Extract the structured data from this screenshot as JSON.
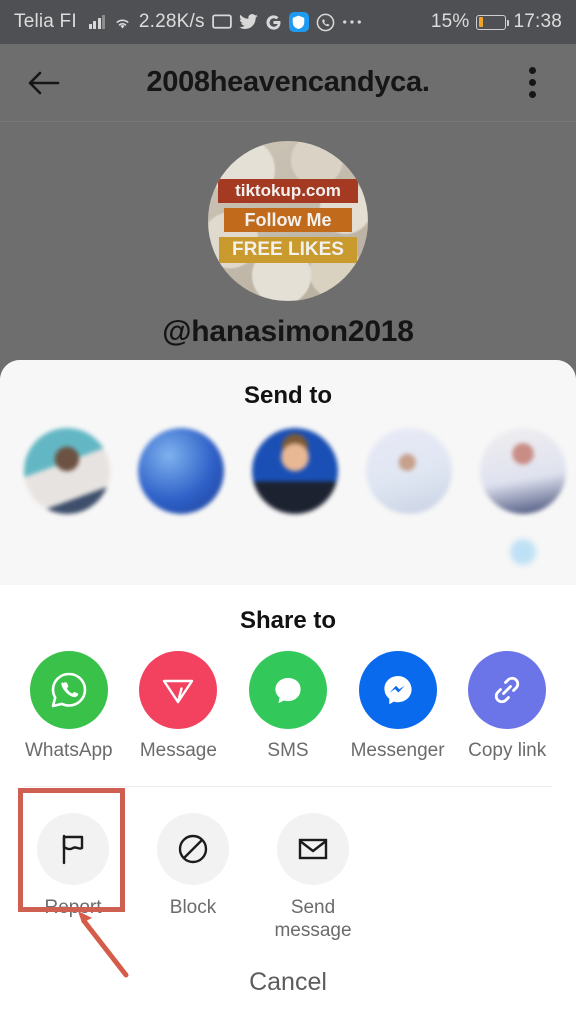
{
  "statusbar": {
    "carrier": "Telia FI",
    "network_speed": "2.28K/s",
    "battery_percent": "15%",
    "clock": "17:38",
    "icons": [
      "signal-icon",
      "wifi-icon",
      "cast-icon",
      "twitter-icon",
      "google-icon",
      "shield-icon",
      "whatsapp-icon",
      "overflow-dots-icon"
    ],
    "battery_fill_color": "#f0a52a"
  },
  "header": {
    "title": "2008heavencandyca.",
    "back_label": "Back",
    "menu_label": "More options"
  },
  "profile": {
    "handle": "@hanasimon2018",
    "avatar_lines": [
      "tiktokup.com",
      "Follow Me",
      "FREE LIKES"
    ],
    "avatar_line_colors": [
      "#a43a22",
      "#c16a1c",
      "#c99a2e"
    ]
  },
  "send_to": {
    "title": "Send to",
    "contacts": [
      {
        "name": "",
        "blurred": true
      },
      {
        "name": "",
        "blurred": true
      },
      {
        "name": "",
        "blurred": true
      },
      {
        "name": "",
        "blurred": true
      },
      {
        "name": "",
        "blurred": true
      }
    ]
  },
  "share_to": {
    "title": "Share to",
    "items": [
      {
        "label": "WhatsApp",
        "icon": "whatsapp-icon",
        "color": "#3ac14a"
      },
      {
        "label": "Message",
        "icon": "paper-plane-icon",
        "color": "#f2days"
      },
      {
        "label": "SMS",
        "icon": "speech-bubble-icon",
        "color": "#32c85a"
      },
      {
        "label": "Messenger",
        "icon": "messenger-icon",
        "color": "#0a6aee"
      },
      {
        "label": "Copy link",
        "icon": "link-chain-icon",
        "color": "#6b75e8"
      }
    ]
  },
  "actions": {
    "items": [
      {
        "label": "Report",
        "icon": "flag-icon",
        "highlighted": true
      },
      {
        "label": "Block",
        "icon": "block-icon",
        "highlighted": false
      },
      {
        "label": "Send message",
        "icon": "envelope-icon",
        "highlighted": false
      }
    ]
  },
  "cancel": {
    "label": "Cancel"
  },
  "annotation": {
    "highlight_color": "#cd6051",
    "target": "Report"
  }
}
